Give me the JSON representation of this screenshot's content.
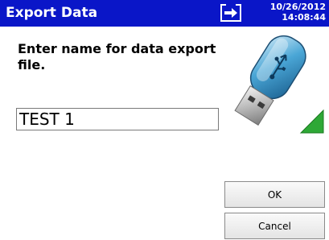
{
  "header": {
    "title": "Export Data",
    "date": "10/26/2012",
    "time": "14:08:44",
    "background_color": "#0a16c8",
    "icon": "export-arrow-icon"
  },
  "main": {
    "prompt": "Enter name for data export file.",
    "filename_value": "TEST 1",
    "illustration_icon": "usb-flash-drive-icon"
  },
  "buttons": {
    "ok_label": "OK",
    "cancel_label": "Cancel"
  }
}
